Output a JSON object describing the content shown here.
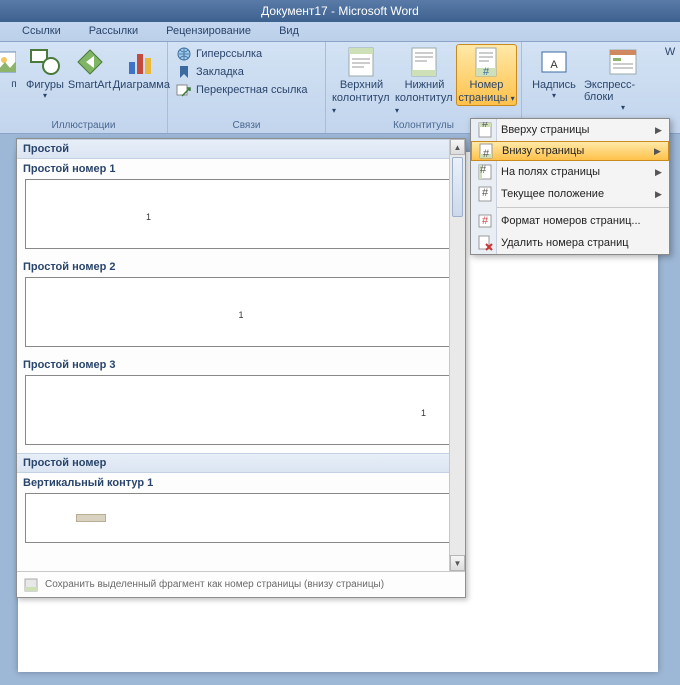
{
  "title": "Документ17 - Microsoft Word",
  "tabs": [
    "Ссылки",
    "Рассылки",
    "Рецензирование",
    "Вид"
  ],
  "ribbon": {
    "group_illustrations": {
      "label": "Иллюстрации",
      "shapes": "Фигуры",
      "smartart": "SmartArt",
      "chart": "Диаграмма"
    },
    "group_links": {
      "label": "Связи",
      "hyperlink": "Гиперссылка",
      "bookmark": "Закладка",
      "crossref": "Перекрестная ссылка"
    },
    "group_headerfooter": {
      "label": "Колонтитулы",
      "header_top": "Верхний",
      "header_sub": "колонтитул",
      "footer_top": "Нижний",
      "footer_sub": "колонтитул",
      "pagenum_top": "Номер",
      "pagenum_sub": "страницы"
    },
    "group_text": {
      "textbox": "Надпись",
      "quickparts": "Экспресс-блоки",
      "wordart_initial": "W"
    }
  },
  "menu": {
    "items": [
      {
        "label": "Вверху страницы",
        "arrow": true
      },
      {
        "label": "Внизу страницы",
        "arrow": true,
        "selected": true
      },
      {
        "label": "На полях страницы",
        "arrow": true
      },
      {
        "label": "Текущее положение",
        "arrow": true
      },
      {
        "label": "Формат номеров страниц...",
        "arrow": false
      },
      {
        "label": "Удалить номера страниц",
        "arrow": false
      }
    ]
  },
  "gallery": {
    "cat1": "Простой",
    "item1": "Простой номер 1",
    "item2": "Простой номер 2",
    "item3": "Простой номер 3",
    "cat2": "Простой номер",
    "item4": "Вертикальный контур 1",
    "num": "1",
    "save_text": "Сохранить выделенный фрагмент как номер страницы (внизу страницы)"
  }
}
